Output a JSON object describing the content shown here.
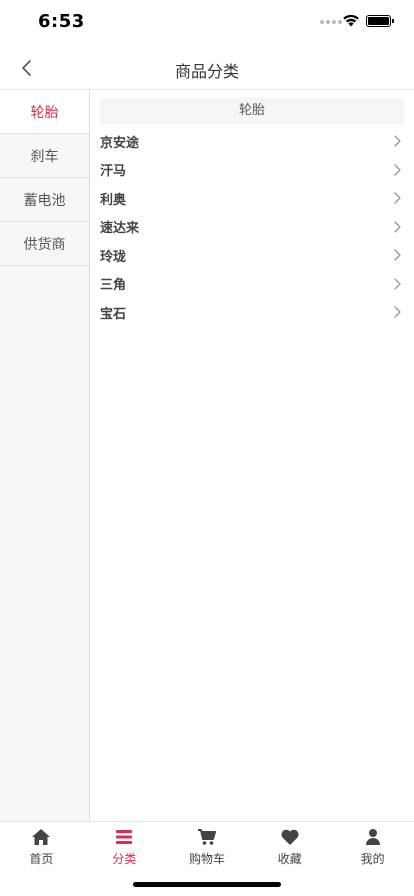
{
  "status_bar": {
    "time": "6:53"
  },
  "nav": {
    "title": "商品分类",
    "back_icon": "chevron-left-icon"
  },
  "sidebar": {
    "items": [
      {
        "label": "轮胎",
        "active": true
      },
      {
        "label": "刹车",
        "active": false
      },
      {
        "label": "蓄电池",
        "active": false
      },
      {
        "label": "供货商",
        "active": false
      }
    ]
  },
  "content": {
    "section_title": "轮胎",
    "brands": [
      "京安途",
      "汗马",
      "利奥",
      "速达来",
      "玲珑",
      "三角",
      "宝石"
    ]
  },
  "tab_bar": {
    "tabs": [
      {
        "label": "首页",
        "icon": "home-icon",
        "active": false
      },
      {
        "label": "分类",
        "icon": "menu-icon",
        "active": true
      },
      {
        "label": "购物车",
        "icon": "cart-icon",
        "active": false
      },
      {
        "label": "收藏",
        "icon": "heart-icon",
        "active": false
      },
      {
        "label": "我的",
        "icon": "user-icon",
        "active": false
      }
    ]
  },
  "colors": {
    "accent": "#d6304f",
    "sidebar_bg": "#f7f7f7",
    "section_header_bg": "#f5f5f5"
  }
}
